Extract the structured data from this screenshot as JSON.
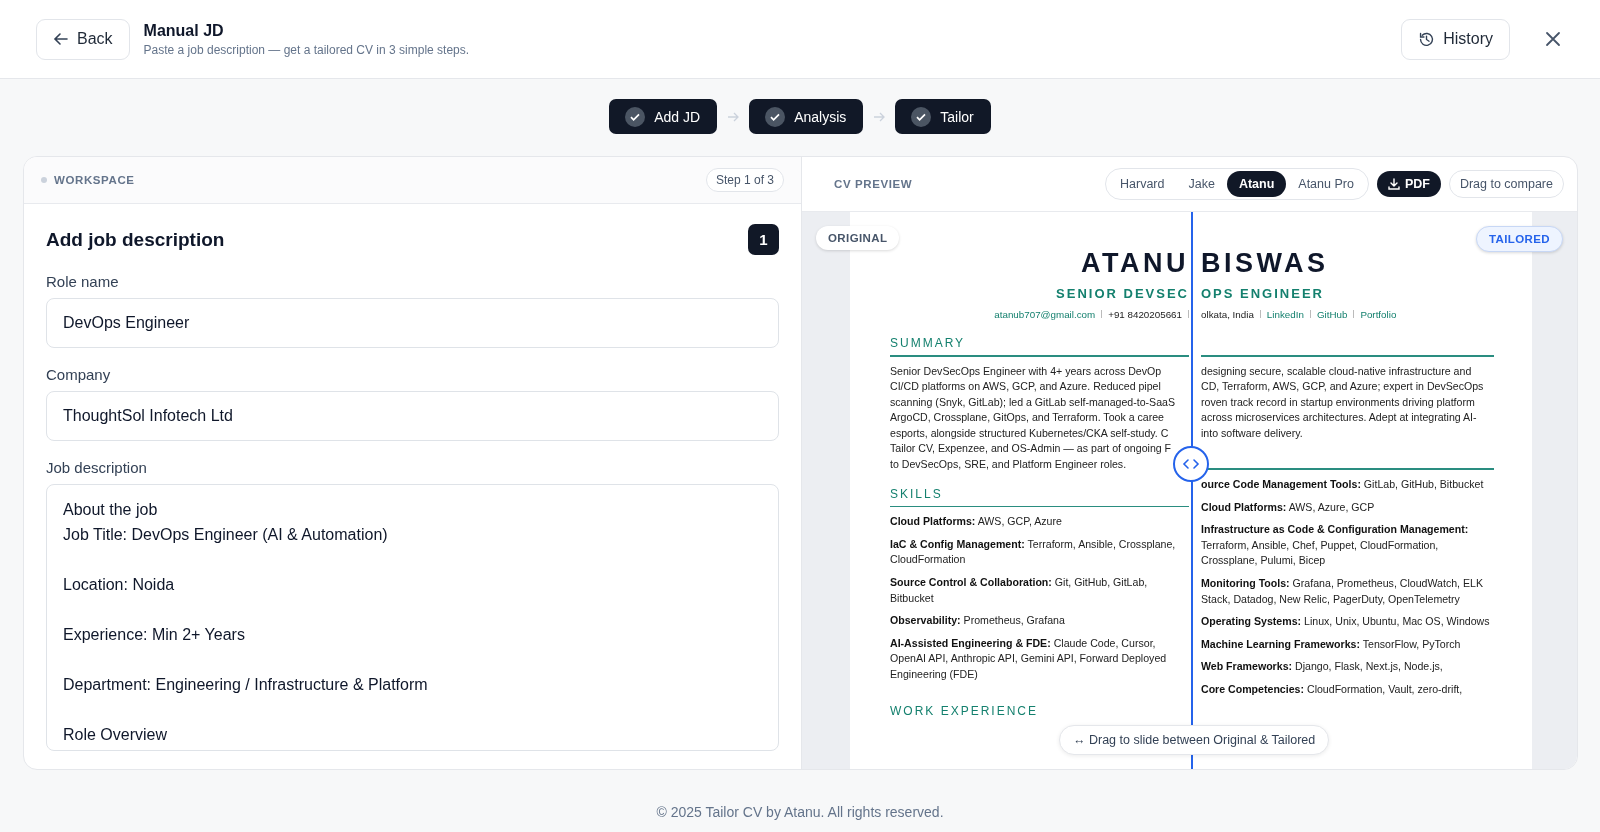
{
  "header": {
    "back_button": "Back",
    "title": "Manual JD",
    "subtitle": "Paste a job description — get a tailored CV in 3 simple steps.",
    "history_button": "History"
  },
  "steps": [
    {
      "label": "Add JD",
      "done": true
    },
    {
      "label": "Analysis",
      "done": true
    },
    {
      "label": "Tailor",
      "done": true
    }
  ],
  "workspace": {
    "label": "WORKSPACE",
    "step_badge": "Step 1 of 3",
    "heading": "Add job description",
    "step_number": "1",
    "fields": [
      {
        "label": "Role name",
        "value": "DevOps Engineer"
      },
      {
        "label": "Company",
        "value": "ThoughtSol Infotech Ltd"
      }
    ],
    "job_description": {
      "label": "Job description",
      "paragraphs": [
        [
          "About the job",
          "Job Title: DevOps Engineer (AI & Automation)"
        ],
        [
          "Location: Noida"
        ],
        [
          "Experience: Min 2+ Years"
        ],
        [
          "Department: Engineering / Infrastructure & Platform"
        ],
        [
          "Role Overview"
        ]
      ]
    }
  },
  "cv_preview": {
    "label": "CV PREVIEW",
    "templates": [
      {
        "label": "Harvard",
        "selected": false
      },
      {
        "label": "Jake",
        "selected": false
      },
      {
        "label": "Atanu",
        "selected": true
      },
      {
        "label": "Atanu Pro",
        "selected": false
      }
    ],
    "pdf_button": "PDF",
    "compare_button": "Drag to compare",
    "original_badge": "ORIGINAL",
    "tailored_badge": "TAILORED",
    "original": {
      "name": "ATANU",
      "title": "SENIOR DEVSEC",
      "contact": [
        {
          "text": "atanub707@gmail.com",
          "link": true
        },
        {
          "text": "+91 8420205661",
          "link": false
        }
      ],
      "summary_heading": "SUMMARY",
      "summary_lines": [
        "Senior DevSecOps Engineer with 4+ years across DevOp",
        "CI/CD platforms on AWS, GCP, and Azure. Reduced pipel",
        "scanning (Snyk, GitLab); led a GitLab self-managed-to-SaaS",
        "ArgoCD, Crossplane, GitOps, and Terraform. Took a caree",
        "esports, alongside structured Kubernetes/CKA self-study. C",
        "Tailor CV, Expenzee, and OS-Admin — as part of ongoing F",
        "to DevSecOps, SRE, and Platform Engineer roles."
      ],
      "skills_heading": "SKILLS",
      "skills": [
        "**Cloud Platforms:** AWS, GCP, Azure",
        "**IaC & Config Management:** Terraform, Ansible, Crossplane, CloudFormation",
        "**Source Control & Collaboration:** Git, GitHub, GitLab, Bitbucket",
        "**Observability:** Prometheus, Grafana",
        "**AI-Assisted Engineering & FDE:** Claude Code, Cursor, OpenAI API, Anthropic API, Gemini API, Forward Deployed Engineering (FDE)"
      ],
      "next_heading": "WORK EXPERIENCE"
    },
    "tailored": {
      "name": "BISWAS",
      "title": "OPS ENGINEER",
      "contact": [
        {
          "text": "olkata, India",
          "link": false
        },
        {
          "text": "LinkedIn",
          "link": true
        },
        {
          "text": "GitHub",
          "link": true
        },
        {
          "text": "Portfolio",
          "link": true
        }
      ],
      "summary_lines": [
        "designing secure, scalable cloud-native infrastructure and",
        "CD, Terraform, AWS, GCP, and Azure; expert in DevSecOps",
        "roven track record in startup environments driving platform",
        "across microservices architectures. Adept at integrating AI-",
        "into software delivery."
      ],
      "skills": [
        "**ource Code Management Tools:** GitLab, GitHub, Bitbucket",
        "**Cloud Platforms:** AWS, Azure, GCP",
        "**Infrastructure as Code & Configuration Management:** Terraform, Ansible, Chef, Puppet, CloudFormation, Crossplane, Pulumi, Bicep",
        "**Monitoring Tools:** Grafana, Prometheus, CloudWatch, ELK Stack, Datadog, New Relic, PagerDuty, OpenTelemetry",
        "**Operating Systems:** Linux, Unix, Ubuntu, Mac OS, Windows",
        "**Machine Learning Frameworks:** TensorFlow, PyTorch",
        "**Web Frameworks:** Django, Flask, Next.js, Node.js,",
        "**Core Competencies:** CloudFormation, Vault, zero-drift,"
      ]
    },
    "slide_hint": "↔ Drag to slide between Original & Tailored"
  },
  "footer": "© 2025 Tailor CV by Atanu. All rights reserved."
}
